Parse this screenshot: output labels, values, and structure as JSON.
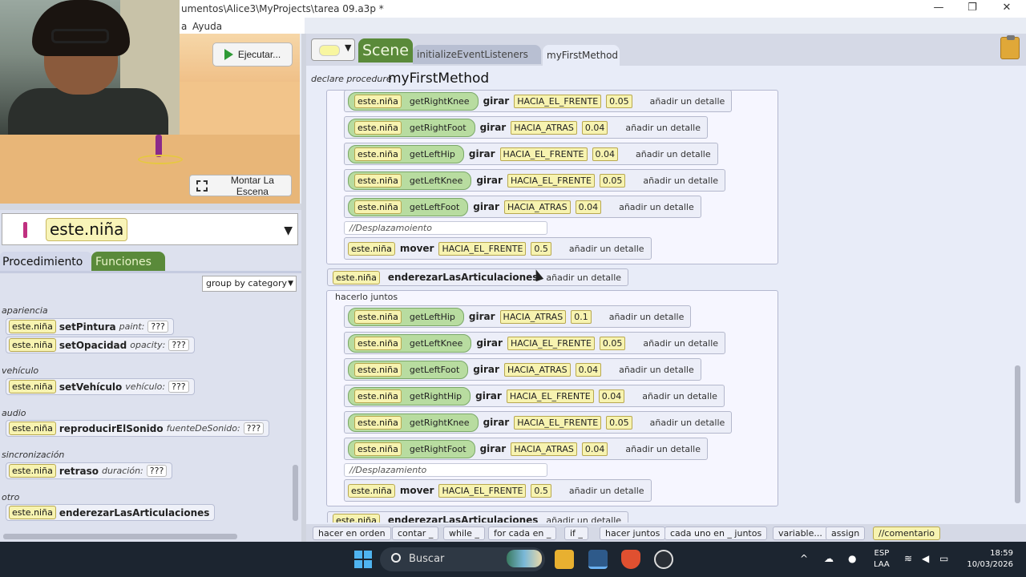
{
  "window": {
    "title": "umentos\\Alice3\\MyProjects\\tarea 09.a3p *",
    "minimize": "—",
    "maximize": "❐",
    "close": "✕"
  },
  "menu": [
    "a",
    "Ayuda"
  ],
  "scene_view": {
    "run_label": "Ejecutar...",
    "setup_scene_label": "Montar La Escena"
  },
  "object_selector": {
    "selected": "este.niña"
  },
  "palette": {
    "tab_procedures": "Procedimiento",
    "tab_functions": "Funciones",
    "group_by": "group by category",
    "categories": [
      {
        "name": "apariencia",
        "items": [
          {
            "target": "este.niña",
            "method": "setPintura",
            "param": "paint:",
            "value": "???"
          },
          {
            "target": "este.niña",
            "method": "setOpacidad",
            "param": "opacity:",
            "value": "???"
          }
        ]
      },
      {
        "name": "vehículo",
        "items": [
          {
            "target": "este.niña",
            "method": "setVehículo",
            "param": "vehículo:",
            "value": "???"
          }
        ]
      },
      {
        "name": "audio",
        "items": [
          {
            "target": "este.niña",
            "method": "reproducirElSonido",
            "param": "fuenteDeSonido:",
            "value": "???"
          }
        ]
      },
      {
        "name": "sincronización",
        "items": [
          {
            "target": "este.niña",
            "method": "retraso",
            "param": "duración:",
            "value": "???"
          }
        ]
      },
      {
        "name": "otro",
        "items": [
          {
            "target": "este.niña",
            "method": "enderezarLasArticulaciones",
            "param": "",
            "value": ""
          }
        ]
      }
    ]
  },
  "editor": {
    "tab_scene": "Scene",
    "tab_listeners": "initializeEventListeners",
    "tab_method": "myFirstMethod",
    "declare_label": "declare procedure",
    "method_name": "myFirstMethod",
    "add_detail": "añadir un detalle",
    "upper_block": {
      "rows": [
        {
          "target": "este.niña",
          "getter": "getRightKnee",
          "verb": "girar",
          "dir": "HACIA_EL_FRENTE",
          "amount": "0.05"
        },
        {
          "target": "este.niña",
          "getter": "getRightFoot",
          "verb": "girar",
          "dir": "HACIA_ATRAS",
          "amount": "0.04"
        },
        {
          "target": "este.niña",
          "getter": "getLeftHip",
          "verb": "girar",
          "dir": "HACIA_EL_FRENTE",
          "amount": "0.04"
        },
        {
          "target": "este.niña",
          "getter": "getLeftKnee",
          "verb": "girar",
          "dir": "HACIA_EL_FRENTE",
          "amount": "0.05"
        },
        {
          "target": "este.niña",
          "getter": "getLeftFoot",
          "verb": "girar",
          "dir": "HACIA_ATRAS",
          "amount": "0.04"
        }
      ],
      "comment": "//Desplazamoiento",
      "move": {
        "target": "este.niña",
        "verb": "mover",
        "dir": "HACIA_EL_FRENTE",
        "amount": "0.5"
      }
    },
    "straighten": {
      "target": "este.niña",
      "method": "enderezarLasArticulaciones"
    },
    "do_together_label": "hacerlo juntos",
    "lower_block": {
      "rows": [
        {
          "target": "este.niña",
          "getter": "getLeftHip",
          "verb": "girar",
          "dir": "HACIA_ATRAS",
          "amount": "0.1"
        },
        {
          "target": "este.niña",
          "getter": "getLeftKnee",
          "verb": "girar",
          "dir": "HACIA_EL_FRENTE",
          "amount": "0.05"
        },
        {
          "target": "este.niña",
          "getter": "getLeftFoot",
          "verb": "girar",
          "dir": "HACIA_ATRAS",
          "amount": "0.04"
        },
        {
          "target": "este.niña",
          "getter": "getRightHip",
          "verb": "girar",
          "dir": "HACIA_EL_FRENTE",
          "amount": "0.04"
        },
        {
          "target": "este.niña",
          "getter": "getRightKnee",
          "verb": "girar",
          "dir": "HACIA_EL_FRENTE",
          "amount": "0.05"
        },
        {
          "target": "este.niña",
          "getter": "getRightFoot",
          "verb": "girar",
          "dir": "HACIA_ATRAS",
          "amount": "0.04"
        }
      ],
      "comment": "//Desplazamiento",
      "move": {
        "target": "este.niña",
        "verb": "mover",
        "dir": "HACIA_EL_FRENTE",
        "amount": "0.5"
      }
    },
    "partial_bottom": {
      "target": "este.niña",
      "method": "enderezarLasArticulaciones"
    }
  },
  "control_bar": [
    "hacer en orden",
    "contar _",
    "while _",
    "for cada en _",
    "if _",
    "hacer juntos",
    "cada uno en _ juntos",
    "variable...",
    "assign",
    "//comentario"
  ],
  "taskbar": {
    "search": "Buscar",
    "lang_top": "ESP",
    "lang_bottom": "LAA",
    "time": "18:59",
    "date": "10/03/2026"
  }
}
